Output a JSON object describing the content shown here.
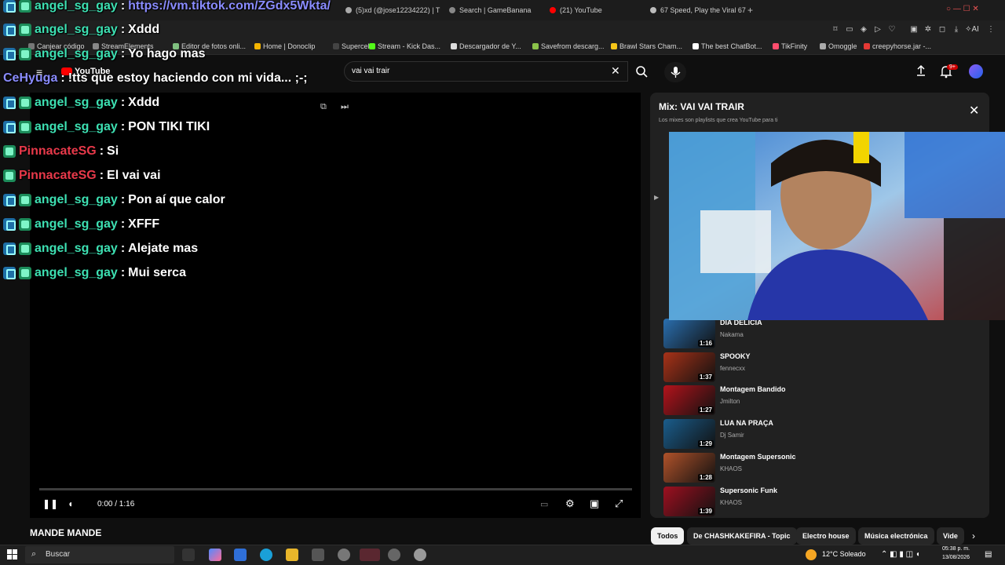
{
  "browser": {
    "tabs": [
      {
        "label": "(5)xd (@jose12234222) | T",
        "color": "#aaaaaa"
      },
      {
        "label": "Search | GameBanana",
        "color": "#888888"
      },
      {
        "label": "(21) YouTube",
        "color": "#ff0000"
      },
      {
        "label": "67 Speed, Play the Viral 67",
        "color": "#bbbbbb"
      }
    ],
    "bookmarks": [
      {
        "label": "Canjear código",
        "color": "#777"
      },
      {
        "label": "StreamElements",
        "color": "#888"
      },
      {
        "label": "Editor de fotos onli...",
        "color": "#7fbf7f"
      },
      {
        "label": "Home | Donoclip",
        "color": "#f4b400"
      },
      {
        "label": "Supercell",
        "color": "#444"
      },
      {
        "label": "Stream - Kick Das...",
        "color": "#53fc18"
      },
      {
        "label": "Descargador de Y...",
        "color": "#ddd"
      },
      {
        "label": "Savefrom descarg...",
        "color": "#8bc34a"
      },
      {
        "label": "Brawl Stars Cham...",
        "color": "#f5c518"
      },
      {
        "label": "The best ChatBot...",
        "color": "#fff"
      },
      {
        "label": "TikFinity",
        "color": "#ff4d6d"
      },
      {
        "label": "Omoggle",
        "color": "#aaa"
      },
      {
        "label": "creepyhorse.jar -...",
        "color": "#e53935"
      }
    ]
  },
  "youtube": {
    "logo": "YouTube",
    "search_value": "vai vai trair",
    "notification_count": "9+",
    "player": {
      "time": "0:00 / 1:16",
      "progress_fraction": 0.0
    },
    "video_title": "MANDE MANDE",
    "playlist": {
      "title": "Mix: VAI VAI TRAIR",
      "subtitle": "Los mixes son playlists que crea YouTube para ti",
      "items": [
        {
          "title": "DIA DELICIA",
          "artist": "Nakama",
          "duration": "1:16",
          "color": "#2a6fb0"
        },
        {
          "title": "SPOOKY",
          "artist": "fennecxx",
          "duration": "1:37",
          "color": "#a83218"
        },
        {
          "title": "Montagem Bandido",
          "artist": "Jmilton",
          "duration": "1:27",
          "color": "#b3131b"
        },
        {
          "title": "LUA NA PRAÇA",
          "artist": "Dj Samir",
          "duration": "1:29",
          "color": "#1a5d8c"
        },
        {
          "title": "Montagem Supersonic",
          "artist": "KHAOS",
          "duration": "1:28",
          "color": "#b0522a"
        },
        {
          "title": "Supersonic Funk",
          "artist": "KHAOS",
          "duration": "1:39",
          "color": "#9e1020"
        }
      ]
    },
    "chips": [
      "Todos",
      "De CHASHKAKEFIRA - Topic",
      "Electro house",
      "Música electrónica",
      "Vide"
    ]
  },
  "chat": [
    {
      "user": "angel_sg_gay",
      "message": "https://vm.tiktok.com/ZGdx5Wkta/",
      "name_color": "green",
      "link": true
    },
    {
      "user": "angel_sg_gay",
      "message": "Xddd",
      "name_color": "green"
    },
    {
      "user": "angel_sg_gay",
      "message": "Yo hago mas",
      "name_color": "green"
    },
    {
      "user": "CeHyuga",
      "message": "!tts que estoy haciendo con mi vida... ;-;",
      "name_color": "blue",
      "no_badge": true
    },
    {
      "user": "angel_sg_gay",
      "message": "Xddd",
      "name_color": "green"
    },
    {
      "user": "angel_sg_gay",
      "message": "PON TIKI TIKI",
      "name_color": "green"
    },
    {
      "user": "PinnacateSG",
      "message": "Si",
      "name_color": "red"
    },
    {
      "user": "PinnacateSG",
      "message": "El vai vai",
      "name_color": "red"
    },
    {
      "user": "angel_sg_gay",
      "message": "Pon aí que calor",
      "name_color": "green"
    },
    {
      "user": "angel_sg_gay",
      "message": "XFFF",
      "name_color": "green"
    },
    {
      "user": "angel_sg_gay",
      "message": "Alejate mas",
      "name_color": "green"
    },
    {
      "user": "angel_sg_gay",
      "message": "Mui serca",
      "name_color": "green"
    }
  ],
  "taskbar": {
    "search_label": "Buscar",
    "weather": "12°C Soleado",
    "time": "05:38 p. m.",
    "date": "13/08/2026"
  }
}
